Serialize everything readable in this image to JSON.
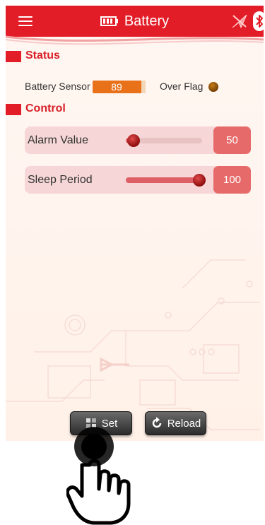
{
  "header": {
    "title": "Battery"
  },
  "status": {
    "title": "Status",
    "battery_sensor_label": "Battery Sensor",
    "battery_sensor_value": "89",
    "over_flag_label": "Over Flag"
  },
  "control": {
    "title": "Control",
    "alarm": {
      "label": "Alarm Value",
      "value": "50",
      "level": 0.1
    },
    "sleep": {
      "label": "Sleep Period",
      "value": "100",
      "level": 0.96
    }
  },
  "buttons": {
    "set": "Set",
    "reload": "Reload"
  },
  "colors": {
    "accent": "#e31d27",
    "sensor": "#e8711a",
    "flag": "#8a4a08",
    "slider": "#e76a6a"
  },
  "icons": [
    "menu-icon",
    "battery-icon",
    "bluetooth-icon",
    "arrow-icon",
    "set-icon",
    "reload-icon",
    "hand-pointer-icon"
  ]
}
